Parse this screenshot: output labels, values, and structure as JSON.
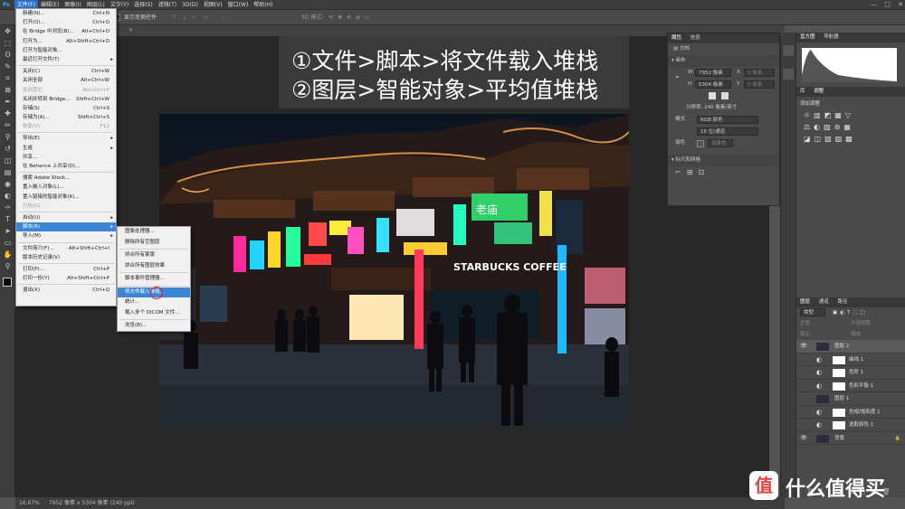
{
  "menubar": {
    "items": [
      "文件(F)",
      "编辑(E)",
      "图像(I)",
      "图层(L)",
      "文字(Y)",
      "选择(S)",
      "滤镜(T)",
      "3D(D)",
      "视图(V)",
      "窗口(W)",
      "帮助(H)"
    ],
    "active_index": 0,
    "window_controls": [
      "—",
      "□",
      "✕"
    ]
  },
  "optionsbar": {
    "show_transform": "显示变换控件",
    "mode_3d": "3D 模式:"
  },
  "overlay": {
    "line1": "①文件>脚本>将文件载入堆栈",
    "line2": "②图层>智能对象>平均值堆栈"
  },
  "file_menu": {
    "items": [
      {
        "label": "新建(N)...",
        "shortcut": "Ctrl+N"
      },
      {
        "label": "打开(O)...",
        "shortcut": "Ctrl+O"
      },
      {
        "label": "在 Bridge 中浏览(B)...",
        "shortcut": "Alt+Ctrl+O"
      },
      {
        "label": "打开为...",
        "shortcut": "Alt+Shift+Ctrl+O"
      },
      {
        "label": "打开为智能对象...",
        "shortcut": ""
      },
      {
        "label": "最近打开文件(T)",
        "shortcut": "",
        "arrow": true
      },
      {
        "sep": true
      },
      {
        "label": "关闭(C)",
        "shortcut": "Ctrl+W"
      },
      {
        "label": "关闭全部",
        "shortcut": "Alt+Ctrl+W"
      },
      {
        "label": "关闭其它",
        "shortcut": "Alt+Ctrl+P",
        "disabled": true
      },
      {
        "label": "关闭并转到 Bridge...",
        "shortcut": "Shift+Ctrl+W"
      },
      {
        "label": "存储(S)",
        "shortcut": "Ctrl+S"
      },
      {
        "label": "存储为(A)...",
        "shortcut": "Shift+Ctrl+S"
      },
      {
        "label": "恢复(V)",
        "shortcut": "F12",
        "disabled": true
      },
      {
        "sep": true
      },
      {
        "label": "导出(E)",
        "shortcut": "",
        "arrow": true
      },
      {
        "label": "生成",
        "shortcut": "",
        "arrow": true
      },
      {
        "label": "共享...",
        "shortcut": ""
      },
      {
        "label": "在 Behance 上共享(D)...",
        "shortcut": ""
      },
      {
        "sep": true
      },
      {
        "label": "搜索 Adobe Stock...",
        "shortcut": ""
      },
      {
        "label": "置入嵌入对象(L)...",
        "shortcut": ""
      },
      {
        "label": "置入链接的智能对象(K)...",
        "shortcut": ""
      },
      {
        "label": "打包(G)...",
        "shortcut": "",
        "disabled": true
      },
      {
        "sep": true
      },
      {
        "label": "自动(U)",
        "shortcut": "",
        "arrow": true
      },
      {
        "label": "脚本(R)",
        "shortcut": "",
        "arrow": true,
        "highlight": true
      },
      {
        "label": "导入(M)",
        "shortcut": "",
        "arrow": true
      },
      {
        "sep": true
      },
      {
        "label": "文件简介(F)...",
        "shortcut": "Alt+Shift+Ctrl+I"
      },
      {
        "label": "版本历史记录(V)",
        "shortcut": ""
      },
      {
        "sep": true
      },
      {
        "label": "打印(P)...",
        "shortcut": "Ctrl+P"
      },
      {
        "label": "打印一份(Y)",
        "shortcut": "Alt+Shift+Ctrl+P"
      },
      {
        "sep": true
      },
      {
        "label": "退出(X)",
        "shortcut": "Ctrl+Q"
      }
    ]
  },
  "script_submenu": {
    "items": [
      {
        "label": "图像处理器..."
      },
      {
        "label": "删除所有空图层"
      },
      {
        "sep": true
      },
      {
        "label": "拼合所有蒙版"
      },
      {
        "label": "拼合所有图层效果"
      },
      {
        "sep": true
      },
      {
        "label": "脚本事件管理器..."
      },
      {
        "sep": true
      },
      {
        "label": "将文件载入堆栈...",
        "highlight": true
      },
      {
        "label": "统计..."
      },
      {
        "label": "载入多个 DICOM 文件..."
      },
      {
        "sep": true
      },
      {
        "label": "浏览(B)..."
      }
    ]
  },
  "properties": {
    "tabs": [
      "属性",
      "信息"
    ],
    "doc_label": "文档",
    "canvas_label": "画布",
    "w_label": "W",
    "w_value": "7952 像素",
    "h_label": "H",
    "h_value": "5304 像素",
    "x_label": "X",
    "y_label": "Y",
    "x_placeholder": "0 像素",
    "y_placeholder": "0 像素",
    "resolution": "分辨率: 240 像素/英寸",
    "mode_label": "模式",
    "mode_value": "RGB 颜色",
    "depth_value": "16 位/通道",
    "fill_label": "填色",
    "fill_value": "背景色",
    "rulers_label": "标尺和网格"
  },
  "right_panels": {
    "hist_tabs": [
      "直方图",
      "导航器"
    ],
    "adj_tabs": [
      "库",
      "调整"
    ],
    "adj_title": "添加调整",
    "layers_tabs": [
      "图层",
      "通道",
      "路径"
    ],
    "kind_label": "类型",
    "blend_mode": "正常",
    "opacity": "不透明度:",
    "lock_label": "锁定:",
    "fill_label": "填充:"
  },
  "layers": [
    {
      "name": "图层 2",
      "visible": true,
      "type": "image"
    },
    {
      "name": "曲线 1",
      "visible": false,
      "type": "adjustment"
    },
    {
      "name": "色阶 1",
      "visible": false,
      "type": "adjustment"
    },
    {
      "name": "色彩平衡 1",
      "visible": false,
      "type": "adjustment"
    },
    {
      "name": "图层 1",
      "visible": false,
      "type": "image"
    },
    {
      "name": "色相/饱和度 1",
      "visible": false,
      "type": "adjustment"
    },
    {
      "name": "选取颜色 1",
      "visible": false,
      "type": "adjustment"
    },
    {
      "name": "背景",
      "visible": true,
      "type": "image",
      "locked": true
    }
  ],
  "status": {
    "zoom": "16.67%",
    "doc_info": "7952 像素 x 5304 像素 (240 ppi)"
  },
  "tools": [
    "move-icon",
    "marquee-icon",
    "lasso-icon",
    "quick-select-icon",
    "crop-icon",
    "frame-icon",
    "eyedropper-icon",
    "healing-icon",
    "brush-icon",
    "stamp-icon",
    "history-brush-icon",
    "eraser-icon",
    "gradient-icon",
    "blur-icon",
    "dodge-icon",
    "pen-icon",
    "type-icon",
    "path-select-icon",
    "shape-icon",
    "hand-icon",
    "zoom-icon"
  ],
  "tool_glyphs": [
    "✥",
    "⬚",
    "ʘ",
    "✎",
    "⌗",
    "⊠",
    "✒",
    "✚",
    "✏",
    "⚲",
    "↺",
    "◫",
    "▤",
    "◉",
    "◐",
    "✑",
    "T",
    "➤",
    "▭",
    "✋",
    "⚲"
  ],
  "photo_signs": {
    "starbucks": "STARBUCKS COFFEE",
    "laomiao": "老庙"
  },
  "watermark": "什么值得买"
}
